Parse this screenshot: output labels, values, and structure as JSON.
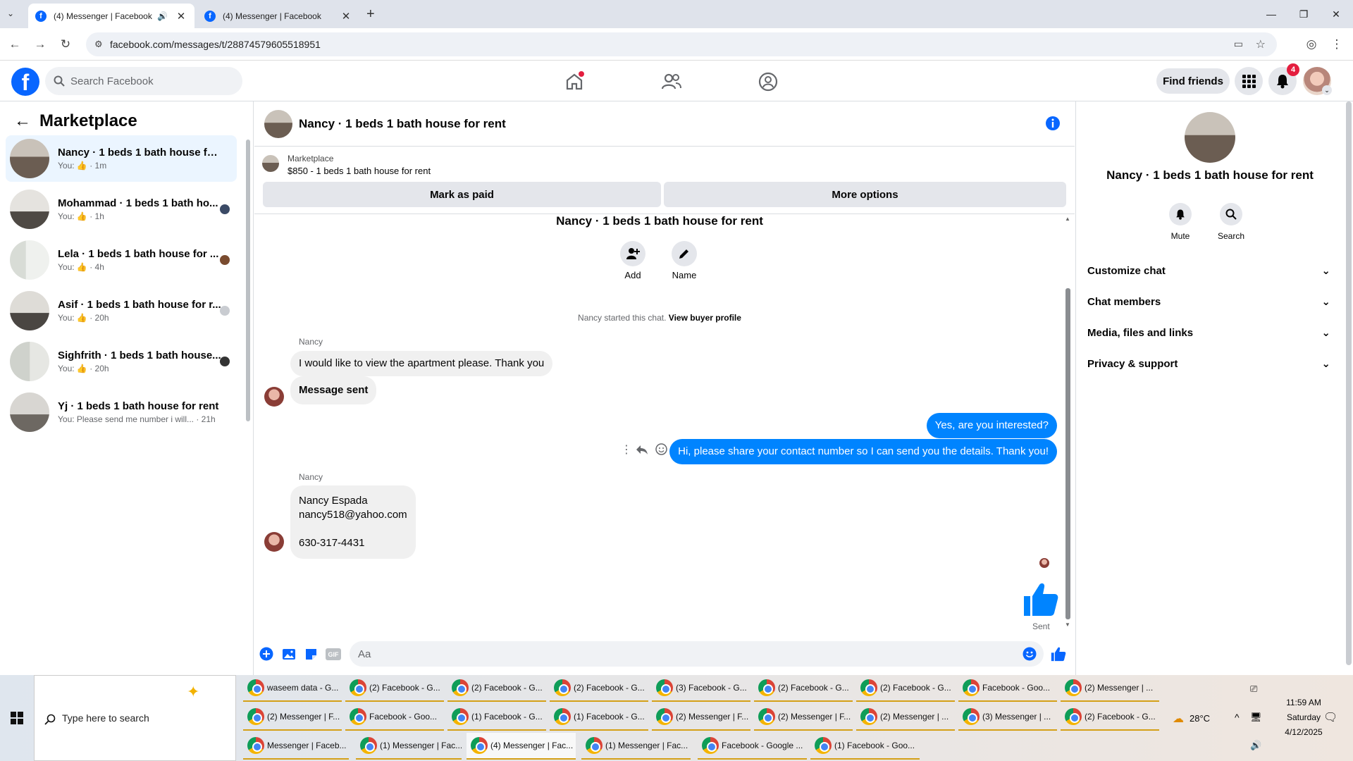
{
  "browser": {
    "tabs": [
      {
        "title": "(4) Messenger | Facebook",
        "active": true
      },
      {
        "title": "(4) Messenger | Facebook",
        "active": false
      }
    ],
    "url": "facebook.com/messages/t/28874579605518951"
  },
  "fb_header": {
    "search_placeholder": "Search Facebook",
    "find_friends": "Find friends",
    "notification_count": "4"
  },
  "sidebar": {
    "title": "Marketplace",
    "conversations": [
      {
        "name": "Nancy · 1 beds 1 bath house for r...",
        "meta": "You: 👍 · 1m"
      },
      {
        "name": "Mohammad · 1 beds 1 bath ho...",
        "meta": "You: 👍 · 1h"
      },
      {
        "name": "Lela · 1 beds 1 bath house for ...",
        "meta": "You: 👍 · 4h"
      },
      {
        "name": "Asif · 1 beds 1 bath house for r...",
        "meta": "You: 👍 · 20h"
      },
      {
        "name": "Sighfrith · 1 beds 1 bath house...",
        "meta": "You: 👍 · 20h"
      },
      {
        "name": "Yj · 1 beds 1 bath house for rent",
        "meta": "You: Please send me number i will... · 21h"
      }
    ]
  },
  "chat": {
    "title": "Nancy · 1 beds 1 bath house for rent",
    "listing_source": "Marketplace",
    "listing_title": "$850 - 1 beds 1 bath house for rent",
    "mark_paid": "Mark as paid",
    "more_options": "More options",
    "intro_name": "Nancy · 1 beds 1 bath house for rent",
    "add_label": "Add",
    "name_label": "Name",
    "started_text": "Nancy started this chat.",
    "buyer_profile": "View buyer profile",
    "sender1": "Nancy",
    "msg1": "I would like to view the apartment please. Thank you",
    "msg2": "Message sent",
    "msg3": "Yes, are you interested?",
    "msg4": "Hi, please share your contact number so I can send you the details. Thank you!",
    "sender2": "Nancy",
    "contact_name": "Nancy Espada",
    "contact_email": "nancy518@yahoo.com",
    "contact_phone": "630-317-4431",
    "sent_label": "Sent",
    "composer_placeholder": "Aa"
  },
  "details": {
    "title": "Nancy · 1 beds 1 bath house for rent",
    "mute": "Mute",
    "search": "Search",
    "sections": [
      "Customize chat",
      "Chat members",
      "Media, files and links",
      "Privacy & support"
    ]
  },
  "taskbar": {
    "search_placeholder": "Type here to search",
    "items_row1": [
      "waseem data - G...",
      "(2) Facebook - G...",
      "(2) Facebook - G...",
      "(2) Facebook - G...",
      "(3) Facebook - G...",
      "(2) Facebook - G...",
      "(2) Facebook - G...",
      "Facebook - Goo...",
      "(2) Messenger | ..."
    ],
    "items_row2": [
      "(2) Messenger | F...",
      "Facebook - Goo...",
      "(1) Facebook - G...",
      "(1) Facebook - G...",
      "(2) Messenger | F...",
      "(2) Messenger | F...",
      "(2) Messenger | ...",
      "(3) Messenger | ...",
      "(2) Facebook - G..."
    ],
    "items_row3": [
      "Messenger | Faceb...",
      "(1) Messenger | Fac...",
      "(4) Messenger | Fac...",
      "(1) Messenger | Fac...",
      "Facebook - Google ...",
      "(1) Facebook - Goo..."
    ],
    "weather": "28°C",
    "time": "11:59 AM",
    "day": "Saturday",
    "date": "4/12/2025"
  },
  "colors": {
    "fb_blue": "#0866ff",
    "messenger_blue": "#0084ff",
    "selected_bg": "#ebf5ff"
  }
}
